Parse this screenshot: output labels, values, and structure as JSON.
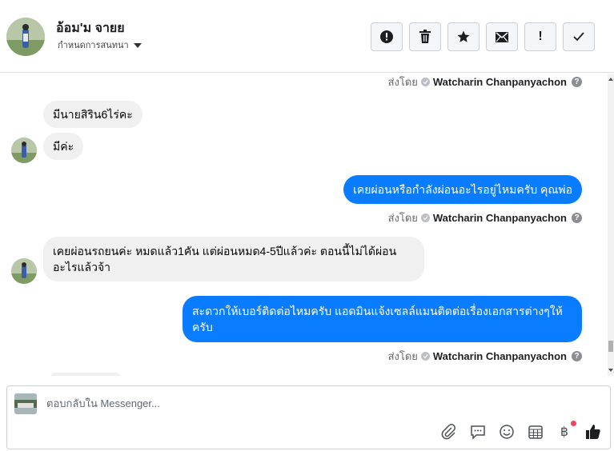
{
  "header": {
    "contact_name": "อ้อม'ม จายย",
    "conversation_label": "กำหนดการสนทนา",
    "toolbar": [
      {
        "name": "report-button",
        "glyph": "!"
      },
      {
        "name": "delete-button",
        "glyph": "🗑"
      },
      {
        "name": "star-button",
        "glyph": "★"
      },
      {
        "name": "mark-unread-button",
        "glyph": "✉"
      },
      {
        "name": "flag-button",
        "glyph": "!"
      },
      {
        "name": "done-button",
        "glyph": "✓"
      }
    ]
  },
  "thread": {
    "sent_by_prefix": "ส่งโดย",
    "sender_name": "Watcharin Chanpanyachon",
    "help_glyph": "?",
    "messages": [
      {
        "side": "in",
        "text": "มีนายสิริน6ไร่คะ"
      },
      {
        "side": "in",
        "text": "มีค่ะ"
      },
      {
        "side": "out",
        "text": "เคยผ่อนหรือกำลังผ่อนอะไรอยู่ไหมครับ คุณพ่อ"
      },
      {
        "side": "in",
        "text": "เคยผ่อนรถยนค่ะ หมดแล้ว1คัน แต่ผ่อนหมด4-5ปีแล้วค่ะ ตอนนี้ไม่ได้ผ่อนอะไรแล้วจ้า"
      },
      {
        "side": "out",
        "text": "สะดวกให้เบอร์ติดต่อไหมครับ แอดมินแจ้งเซลล์แมนติดต่อเรื่องเอกสารต่างๆให้ครับ"
      }
    ]
  },
  "composer": {
    "placeholder": "ตอบกลับใน Messenger...",
    "tools": [
      {
        "name": "attach-icon",
        "glyph": "📎"
      },
      {
        "name": "saved-replies-icon",
        "glyph": "💬"
      },
      {
        "name": "emoji-icon",
        "glyph": "☺"
      },
      {
        "name": "appointment-icon",
        "glyph": "▦"
      },
      {
        "name": "payment-icon",
        "glyph": "฿"
      },
      {
        "name": "like-icon",
        "glyph": "👍"
      }
    ]
  },
  "colors": {
    "outgoing_bubble": "#0a7cff",
    "incoming_bubble": "#f0f0f0",
    "notification_dot": "#f3425f"
  }
}
